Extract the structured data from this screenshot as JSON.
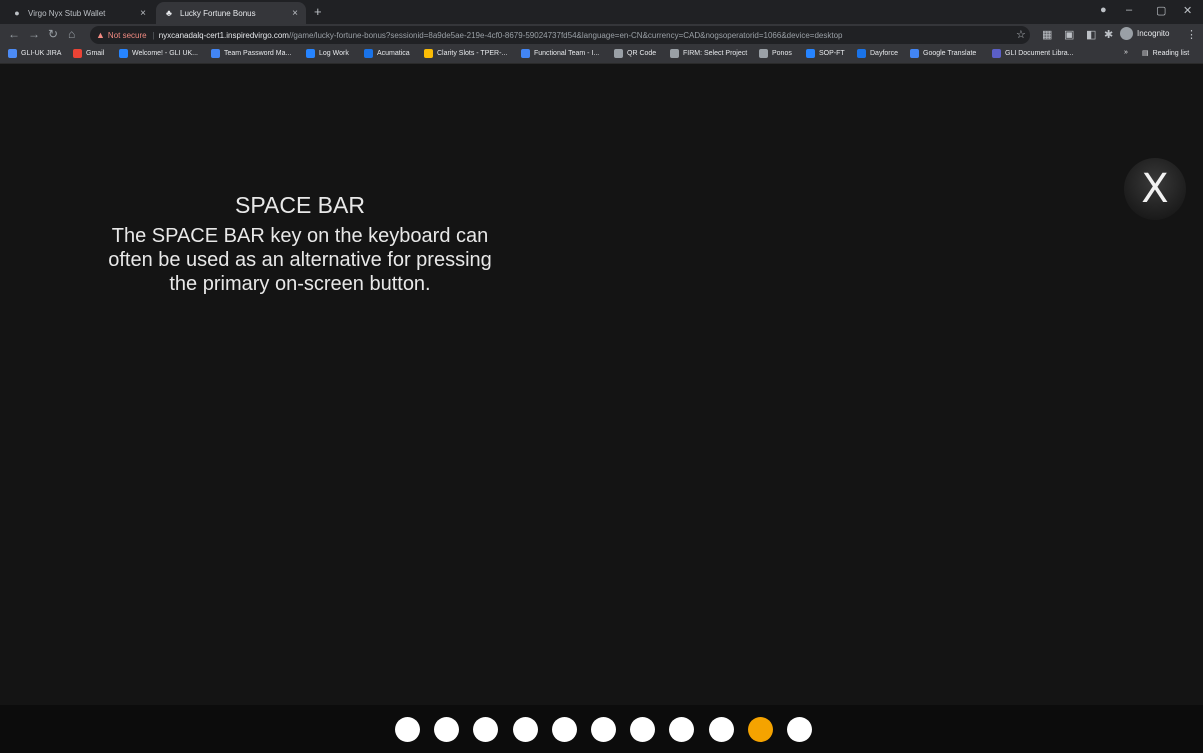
{
  "browser": {
    "tabs": [
      {
        "title": "Virgo Nyx Stub Wallet",
        "active": false
      },
      {
        "title": "Lucky Fortune Bonus",
        "active": true
      }
    ],
    "new_tab_label": "+",
    "tab_close_glyph": "×",
    "window_controls": [
      "–",
      "▢",
      "✕"
    ],
    "omnibox": {
      "warning_text": "Not secure",
      "host": "nyxcanadalq-cert1.inspiredvirgo.com",
      "path": "//game/lucky-fortune-bonus?sessionid=8a9de5ae-219e-4cf0-8679-59024737fd54&language=en-CN&currency=CAD&nogsoperatorid=1066&device=desktop"
    },
    "profile_label": "Incognito",
    "bookmarks": [
      {
        "label": "GLI-UK JIRA",
        "color": "#4c8bf5"
      },
      {
        "label": "Gmail",
        "color": "#ea4335"
      },
      {
        "label": "Welcome! - GLI UK...",
        "color": "#2684ff"
      },
      {
        "label": "Team Password Ma...",
        "color": "#4285f4"
      },
      {
        "label": "Log Work",
        "color": "#2684ff"
      },
      {
        "label": "Acumatica",
        "color": "#1a73e8"
      },
      {
        "label": "Clarity Slots - TPER-...",
        "color": "#fbbc05"
      },
      {
        "label": "Functional Team - I...",
        "color": "#4285f4"
      },
      {
        "label": "QR Code",
        "color": "#9aa0a6"
      },
      {
        "label": "FIRM: Select Project",
        "color": "#9aa0a6"
      },
      {
        "label": "Ponos",
        "color": "#9aa0a6"
      },
      {
        "label": "SOP-FT",
        "color": "#2684ff"
      },
      {
        "label": "Dayforce",
        "color": "#1a73e8"
      },
      {
        "label": "Google Translate",
        "color": "#4285f4"
      },
      {
        "label": "GLI Document Libra...",
        "color": "#5b5fc7"
      }
    ],
    "bookmarks_overflow": "»",
    "reading_list_label": "Reading list"
  },
  "help": {
    "title": "SPACE BAR",
    "lines": [
      "The SPACE BAR key on the keyboard can",
      "often be used as an alternative for pressing",
      "the primary on-screen button."
    ],
    "close_glyph": "X"
  },
  "pager": {
    "total": 11,
    "current": 10,
    "active_color": "#f5a300",
    "inactive_color": "#ffffff"
  }
}
